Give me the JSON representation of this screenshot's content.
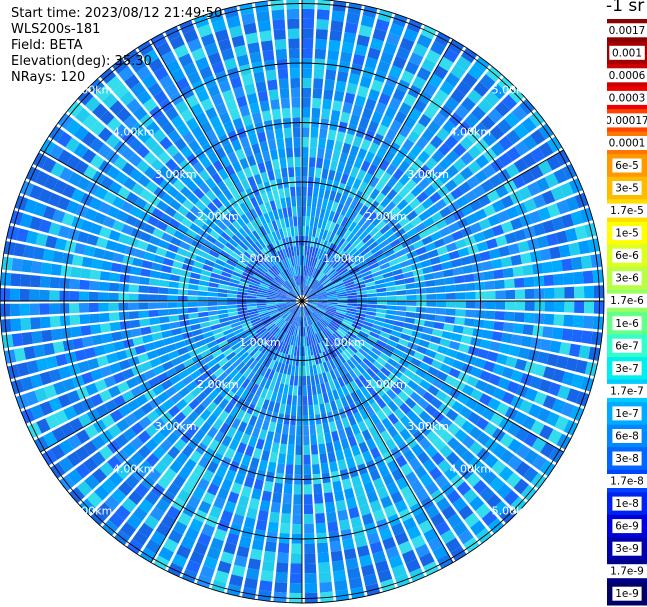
{
  "header": {
    "start_time": "Start time: 2023/08/12 21:49:50",
    "instrument": "WLS200s-181",
    "field": "Field: BETA",
    "elevation": "Elevation(deg): 35.30",
    "nrays": "NRays: 120"
  },
  "chart_data": {
    "type": "heatmap",
    "projection": "polar-ppi",
    "field": "BETA",
    "elevation_deg": 35.3,
    "n_rays": 120,
    "range_rings_km": [
      1.0,
      2.0,
      3.0,
      4.0,
      5.0
    ],
    "ring_labels": [
      "1.00km",
      "2.00km",
      "3.00km",
      "4.00km",
      "5.00km"
    ],
    "spokes_deg": [
      0,
      30,
      60,
      90,
      120,
      150,
      180,
      210,
      240,
      270,
      300,
      330
    ],
    "colorbar": {
      "unit": "-1 sr",
      "labels": [
        "0.0017",
        "0.001",
        "0.0006",
        "0.0003",
        "0.00017",
        "0.0001",
        "6e-5",
        "3e-5",
        "1.7e-5",
        "1e-5",
        "6e-6",
        "3e-6",
        "1.7e-6",
        "1e-6",
        "6e-7",
        "3e-7",
        "1.7e-7",
        "1e-7",
        "6e-8",
        "3e-8",
        "1.7e-8",
        "1e-8",
        "6e-9",
        "3e-9",
        "1.7e-9",
        "1e-9"
      ],
      "colors": [
        "#8b0000",
        "#a50000",
        "#cc0000",
        "#ee0000",
        "#ff4400",
        "#ff7700",
        "#ff9900",
        "#ffbb00",
        "#ffdd00",
        "#ffff00",
        "#ddff22",
        "#bbff44",
        "#99ff66",
        "#66ff88",
        "#33ffcc",
        "#00eeee",
        "#00ccff",
        "#00aaff",
        "#0088ff",
        "#0066ff",
        "#0044ff",
        "#0022ee",
        "#0000dd",
        "#0000aa",
        "#000088",
        "#000066"
      ]
    }
  }
}
